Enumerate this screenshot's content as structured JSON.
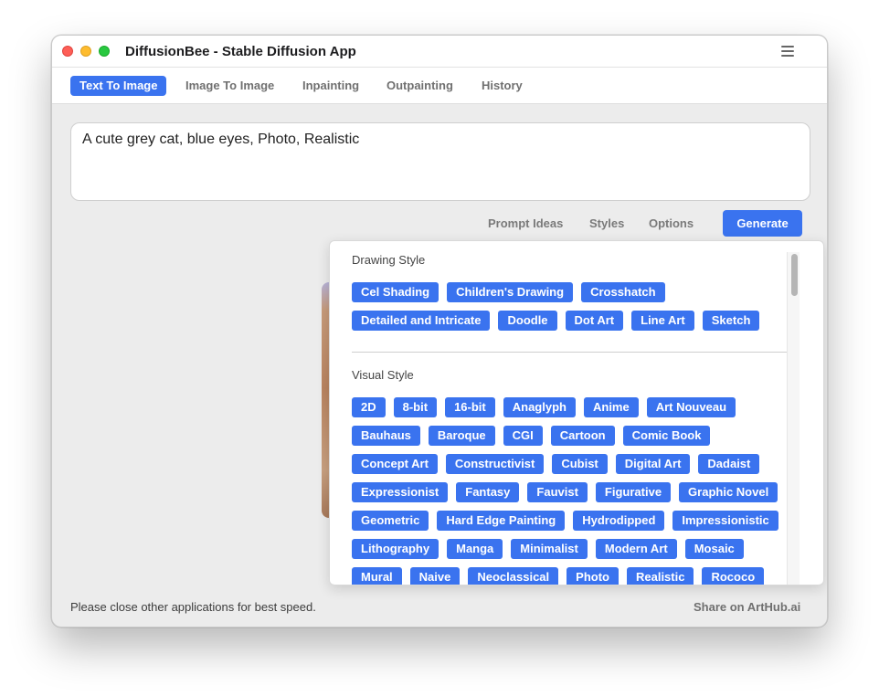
{
  "app": {
    "title": "DiffusionBee - Stable Diffusion App"
  },
  "tabs": [
    {
      "label": "Text To Image",
      "active": true
    },
    {
      "label": "Image To Image"
    },
    {
      "label": "Inpainting"
    },
    {
      "label": "Outpainting"
    },
    {
      "label": "History"
    }
  ],
  "prompt": {
    "value": "A cute grey cat, blue eyes, Photo, Realistic"
  },
  "actions": {
    "prompt_ideas": "Prompt Ideas",
    "styles": "Styles",
    "options": "Options",
    "generate": "Generate"
  },
  "styles_panel": {
    "drawing_style": {
      "title": "Drawing Style",
      "items": [
        "Cel Shading",
        "Children's Drawing",
        "Crosshatch",
        "Detailed and Intricate",
        "Doodle",
        "Dot Art",
        "Line Art",
        "Sketch"
      ]
    },
    "visual_style": {
      "title": "Visual Style",
      "items": [
        "2D",
        "8-bit",
        "16-bit",
        "Anaglyph",
        "Anime",
        "Art Nouveau",
        "Bauhaus",
        "Baroque",
        "CGI",
        "Cartoon",
        "Comic Book",
        "Concept Art",
        "Constructivist",
        "Cubist",
        "Digital Art",
        "Dadaist",
        "Expressionist",
        "Fantasy",
        "Fauvist",
        "Figurative",
        "Graphic Novel",
        "Geometric",
        "Hard Edge Painting",
        "Hydrodipped",
        "Impressionistic",
        "Lithography",
        "Manga",
        "Minimalist",
        "Modern Art",
        "Mosaic",
        "Mural",
        "Naive",
        "Neoclassical",
        "Photo",
        "Realistic",
        "Rococo"
      ]
    }
  },
  "footer": {
    "note": "Please close other applications for best speed.",
    "share": "Share on ArtHub.ai"
  },
  "colors": {
    "accent": "#3a73ef",
    "close": "#fe5f57",
    "minimize": "#febc2e",
    "maximize": "#28c840"
  },
  "icons": [
    "hamburger-menu-icon"
  ]
}
